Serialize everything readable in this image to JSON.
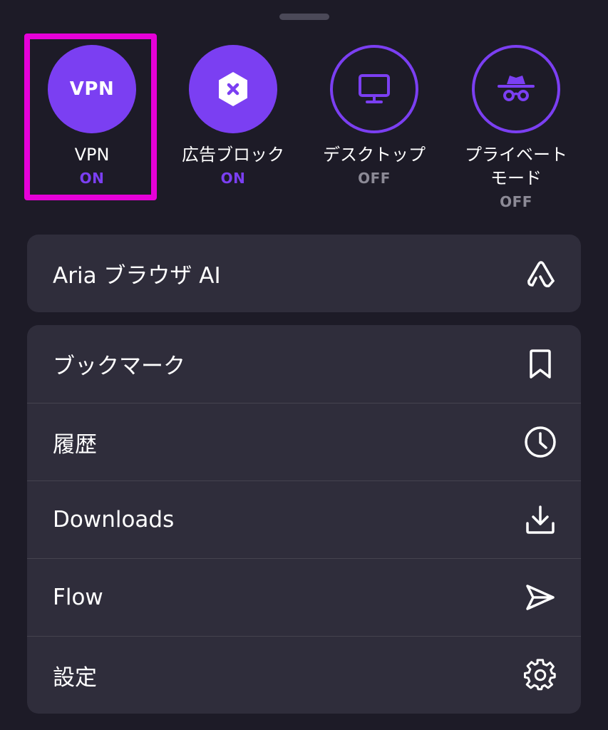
{
  "toggles": [
    {
      "name": "vpn",
      "icon_text": "VPN",
      "label": "VPN",
      "state": "ON",
      "active": true
    },
    {
      "name": "ad-block",
      "icon": "block-icon",
      "label": "広告ブロック",
      "state": "ON",
      "active": true
    },
    {
      "name": "desktop",
      "icon": "monitor-icon",
      "label": "デスクトップ",
      "state": "OFF",
      "active": false
    },
    {
      "name": "private-mode",
      "icon": "incognito-icon",
      "label_line1": "プライベート",
      "label_line2": "モード",
      "state": "OFF",
      "active": false
    }
  ],
  "aria": {
    "label": "Aria ブラウザ AI",
    "icon": "aria-logo-icon"
  },
  "menu": [
    {
      "label": "ブックマーク",
      "icon": "bookmark-icon"
    },
    {
      "label": "履歴",
      "icon": "clock-icon"
    },
    {
      "label": "Downloads",
      "icon": "download-icon"
    },
    {
      "label": "Flow",
      "icon": "send-icon"
    },
    {
      "label": "設定",
      "icon": "gear-icon"
    }
  ],
  "colors": {
    "background": "#1d1b27",
    "card": "#2f2d3b",
    "accent": "#7b3ff2",
    "highlight": "#e600d8",
    "muted": "#8c8a96"
  }
}
